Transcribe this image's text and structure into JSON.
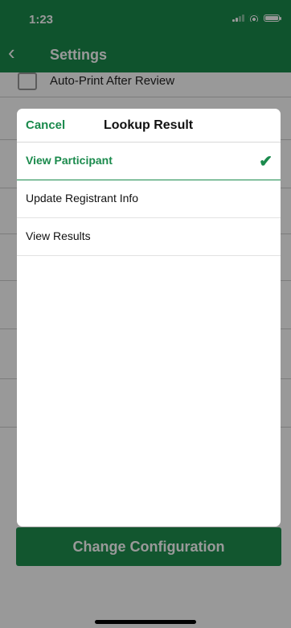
{
  "status_bar": {
    "time": "1:23"
  },
  "nav": {
    "title": "Settings"
  },
  "background": {
    "checkbox_label": "Auto-Print After Review",
    "button_label": "Change Configuration"
  },
  "modal": {
    "cancel_label": "Cancel",
    "title": "Lookup Result",
    "options": [
      {
        "label": "View Participant",
        "selected": true
      },
      {
        "label": "Update Registrant Info",
        "selected": false
      },
      {
        "label": "View Results",
        "selected": false
      }
    ],
    "selected_icon": "checkmark-icon"
  },
  "colors": {
    "brand_green": "#1a8a4c"
  }
}
